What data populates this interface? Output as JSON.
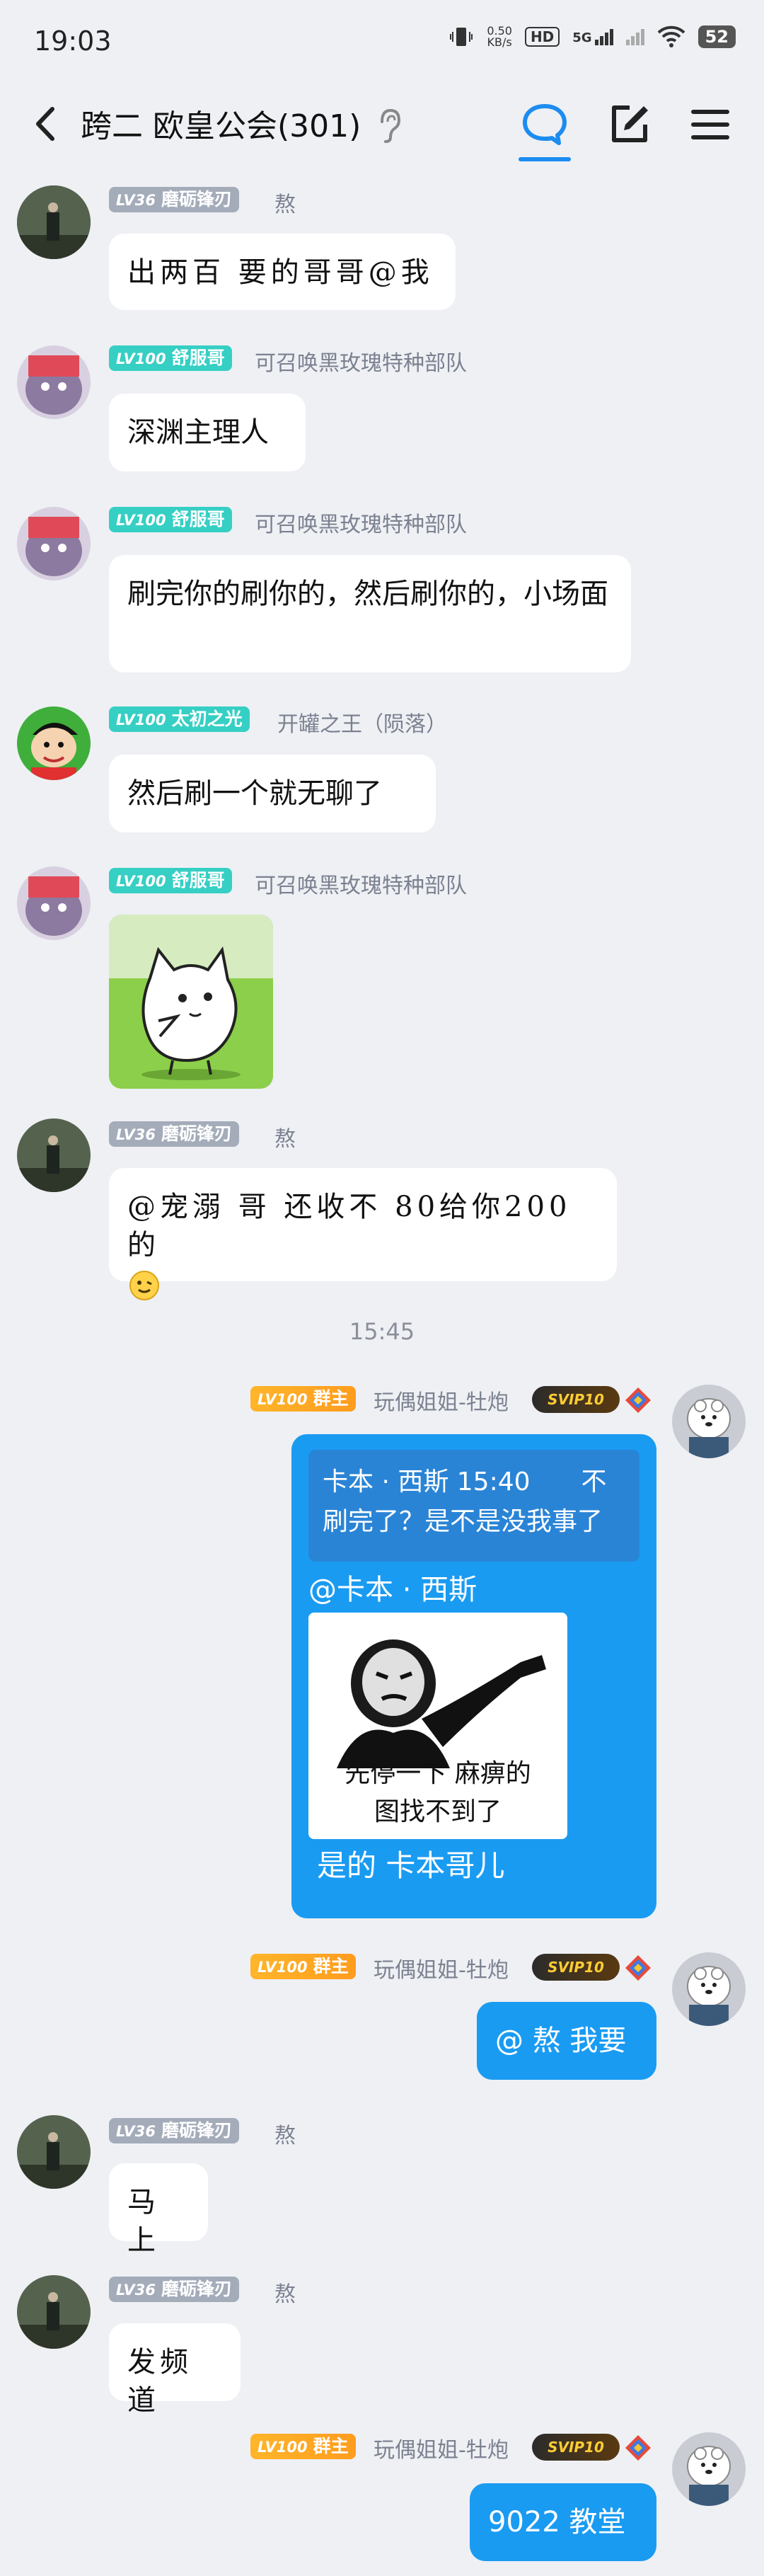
{
  "status_bar": {
    "time": "19:03",
    "net_speed": "0.50",
    "net_unit": "KB/s",
    "hd": "HD",
    "signal": "5G",
    "battery": "52"
  },
  "header": {
    "title": "跨二 欧皇公会(301)"
  },
  "messages": [
    {
      "level": "LV36",
      "name": "磨砺锋刃",
      "title": "熬",
      "text": "出两百 要的哥哥@我"
    },
    {
      "level": "LV100",
      "name": "舒服哥",
      "title": "可召唤黑玫瑰特种部队",
      "text": "深渊主理人"
    },
    {
      "level": "LV100",
      "name": "舒服哥",
      "title": "可召唤黑玫瑰特种部队",
      "text": "刷完你的刷你的，然后刷你的，小场面"
    },
    {
      "level": "LV100",
      "name": "太初之光",
      "title": "开罐之王（陨落）",
      "text": "然后刷一个就无聊了"
    },
    {
      "level": "LV100",
      "name": "舒服哥",
      "title": "可召唤黑玫瑰特种部队"
    },
    {
      "level": "LV36",
      "name": "磨砺锋刃",
      "title": "熬",
      "text": "@宠溺 哥 还收不 80给你200的"
    },
    {
      "time": "15:45"
    },
    {
      "level": "LV100",
      "role": "群主",
      "name": "玩偶姐姐-牡炮",
      "svip": "SVIP10",
      "quote": "卡本 · 西斯 15:40　　不刷完了？是不是没我事了",
      "mention": "@卡本 · 西斯",
      "meme_top": "先停一下 麻痹的",
      "meme_bottom": "图找不到了",
      "text": "是的 卡本哥儿"
    },
    {
      "level": "LV100",
      "role": "群主",
      "name": "玩偶姐姐-牡炮",
      "svip": "SVIP10",
      "text": "@ 熬 我要"
    },
    {
      "level": "LV36",
      "name": "磨砺锋刃",
      "title": "熬",
      "text": "马上"
    },
    {
      "level": "LV36",
      "name": "磨砺锋刃",
      "title": "熬",
      "text": "发频道"
    },
    {
      "level": "LV100",
      "role": "群主",
      "name": "玩偶姐姐-牡炮",
      "svip": "SVIP10",
      "text": "9022 教堂"
    }
  ],
  "icons": {
    "back": "back-arrow-icon",
    "ear": "ear-icon",
    "chat": "chat-bubble-icon",
    "edit": "edit-icon",
    "menu": "menu-icon"
  },
  "colors": {
    "bg": "#eef0f4",
    "self_bubble": "#1a9bf2",
    "tab_accent": "#1c8cf0",
    "lv_gray": "#a4acba",
    "lv_teal": "#36cfc4",
    "lv_orange": "#ffa524"
  }
}
